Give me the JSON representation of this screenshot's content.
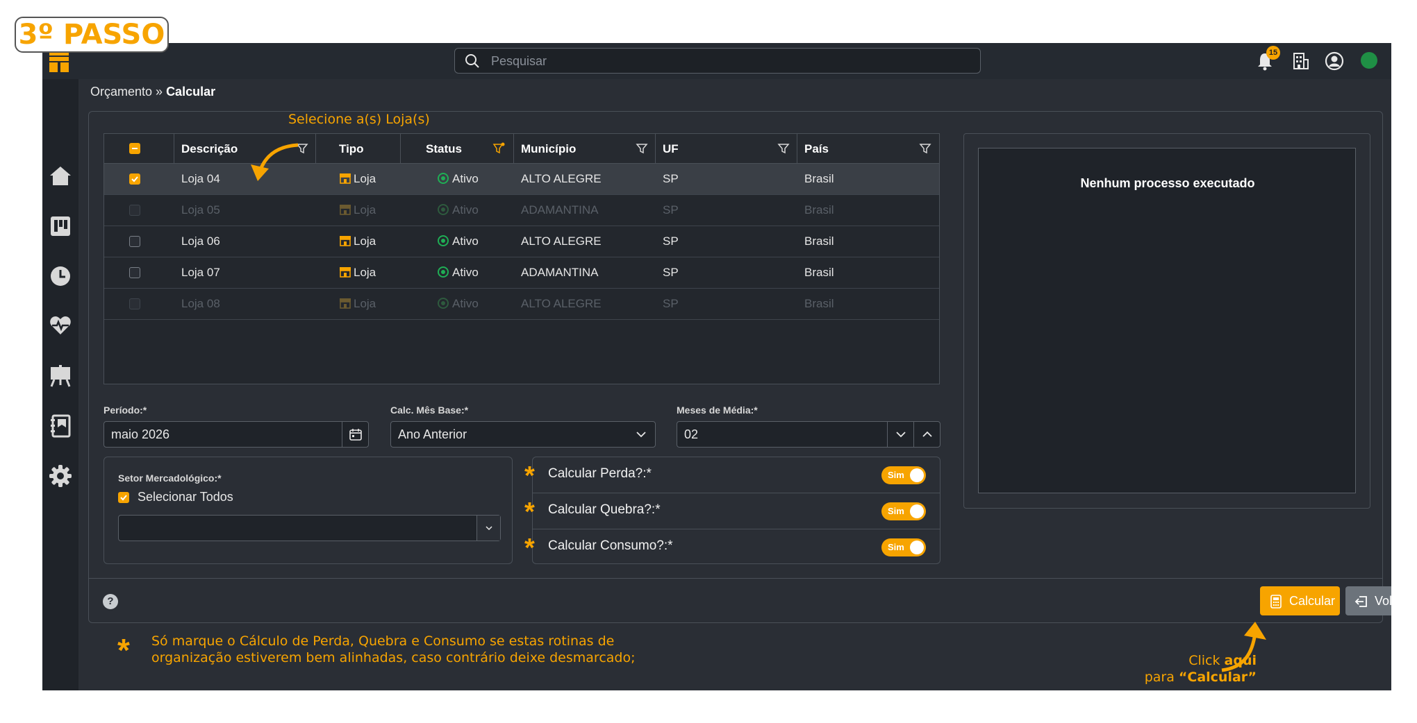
{
  "step_badge": "3º PASSO",
  "search": {
    "placeholder": "Pesquisar"
  },
  "notifications": {
    "count": "15"
  },
  "breadcrumb": {
    "parent": "Orçamento",
    "separator": " » ",
    "current": "Calcular"
  },
  "annotations": {
    "select_stores": "Selecione a(s) Loja(s)",
    "note_star": "*",
    "note_line1": "Só marque o Cálculo de Perda, Quebra e Consumo se estas rotinas de",
    "note_line2": "organização estiverem bem alinhadas, caso contrário deixe desmarcado;",
    "click_line1_a": "Click ",
    "click_line1_b": "aqui",
    "click_line2_a": "para ",
    "click_line2_b": "“Calcular”"
  },
  "table": {
    "columns": [
      "Descrição",
      "Tipo",
      "Status",
      "Município",
      "UF",
      "País"
    ],
    "rows": [
      {
        "descricao": "Loja 04",
        "tipo": "Loja",
        "status": "Ativo",
        "municipio": "ALTO ALEGRE",
        "uf": "SP",
        "pais": "Brasil",
        "checked": true,
        "disabled": false
      },
      {
        "descricao": "Loja 05",
        "tipo": "Loja",
        "status": "Ativo",
        "municipio": "ADAMANTINA",
        "uf": "SP",
        "pais": "Brasil",
        "checked": false,
        "disabled": true
      },
      {
        "descricao": "Loja 06",
        "tipo": "Loja",
        "status": "Ativo",
        "municipio": "ALTO ALEGRE",
        "uf": "SP",
        "pais": "Brasil",
        "checked": false,
        "disabled": false
      },
      {
        "descricao": "Loja 07",
        "tipo": "Loja",
        "status": "Ativo",
        "municipio": "ADAMANTINA",
        "uf": "SP",
        "pais": "Brasil",
        "checked": false,
        "disabled": false
      },
      {
        "descricao": "Loja 08",
        "tipo": "Loja",
        "status": "Ativo",
        "municipio": "ALTO ALEGRE",
        "uf": "SP",
        "pais": "Brasil",
        "checked": false,
        "disabled": true
      }
    ]
  },
  "form": {
    "periodo_label": "Período:*",
    "periodo_value": "maio 2026",
    "mes_base_label": "Calc. Mês Base:*",
    "mes_base_value": "Ano Anterior",
    "meses_media_label": "Meses de Média:*",
    "meses_media_value": "02",
    "setor_label": "Setor Mercadológico:*",
    "selecionar_todos": "Selecionar Todos",
    "setor_value": ""
  },
  "toggles": [
    {
      "label": "Calcular Perda?:*",
      "value": "Sim"
    },
    {
      "label": "Calcular Quebra?:*",
      "value": "Sim"
    },
    {
      "label": "Calcular Consumo?:*",
      "value": "Sim"
    }
  ],
  "output": {
    "message": "Nenhum processo executado"
  },
  "footer": {
    "help": "?",
    "calcular": "Calcular",
    "voltar": "Voltar"
  },
  "colors": {
    "accent": "#f7a400",
    "background": "#2a2e35",
    "success": "#1fae55"
  }
}
